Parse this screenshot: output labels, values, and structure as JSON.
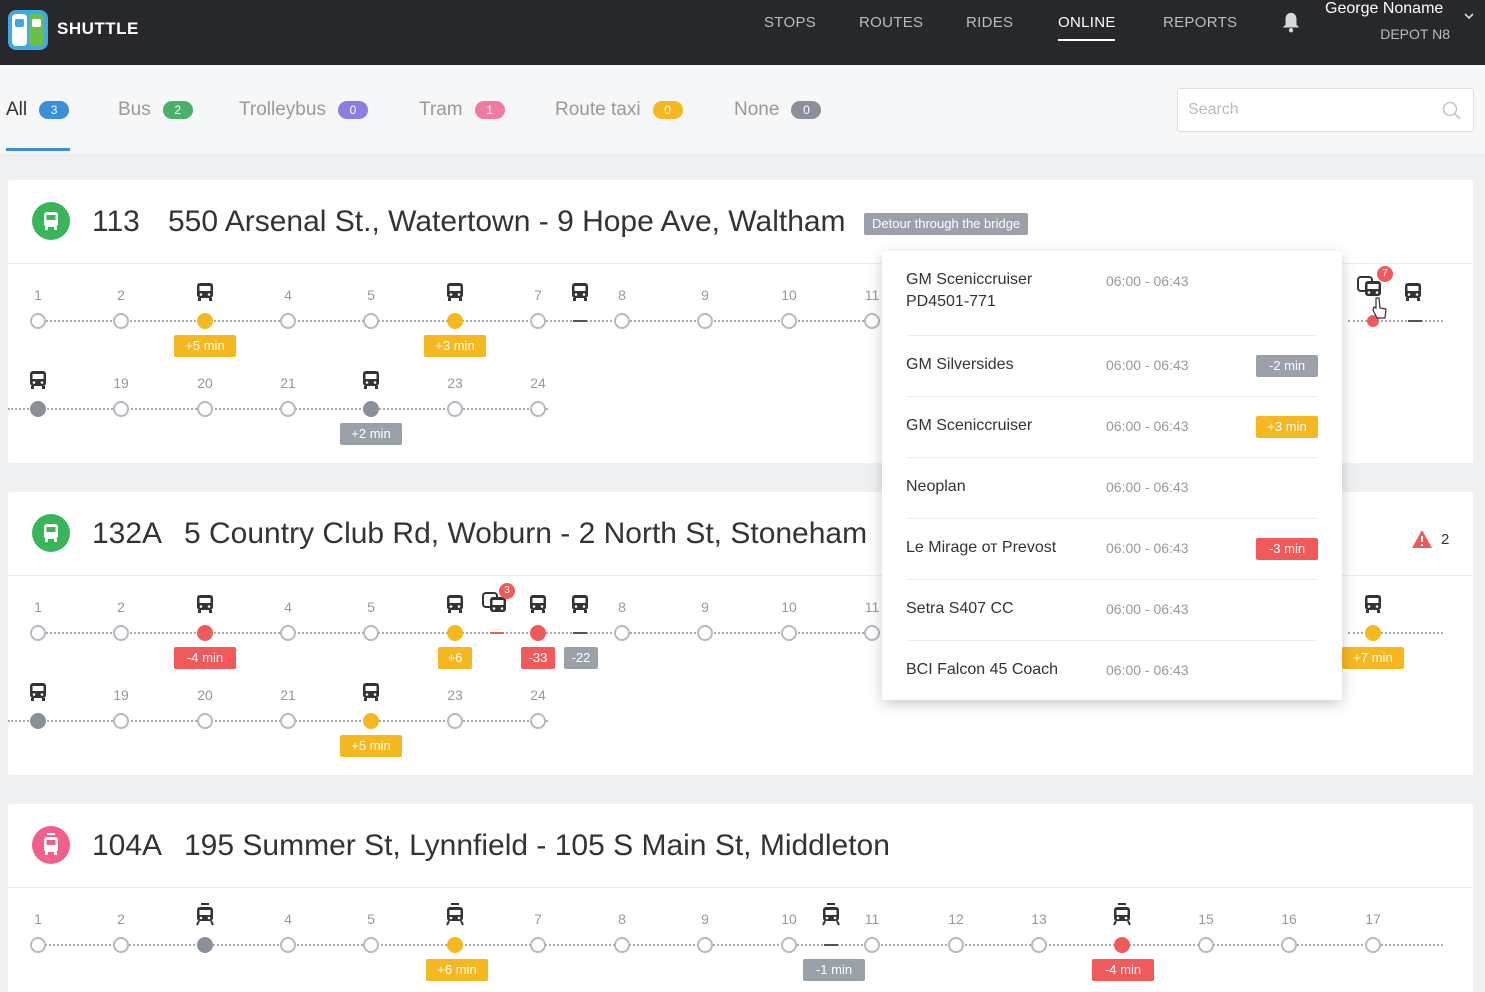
{
  "app": {
    "brand": "SHUTTLE"
  },
  "nav": {
    "items": [
      "STOPS",
      "ROUTES",
      "RIDES",
      "ONLINE",
      "REPORTS"
    ],
    "active": "ONLINE"
  },
  "user": {
    "name": "George Noname",
    "depot": "DEPOT N8"
  },
  "tabs": [
    {
      "label": "All",
      "count": "3",
      "color": "#3b8fd9"
    },
    {
      "label": "Bus",
      "count": "2",
      "color": "#4cb06a"
    },
    {
      "label": "Trolleybus",
      "count": "0",
      "color": "#8c7ee0"
    },
    {
      "label": "Tram",
      "count": "1",
      "color": "#f07aa0"
    },
    {
      "label": "Route taxi",
      "count": "0",
      "color": "#f5b820"
    },
    {
      "label": "None",
      "count": "0",
      "color": "#8a9099"
    }
  ],
  "search": {
    "placeholder": "Search"
  },
  "colors": {
    "green": "#3ab55c",
    "pink": "#f0608a",
    "orange": "#f5b820",
    "red": "#f05a5a",
    "gray": "#9aa1a9",
    "nav_bg": "#26282c"
  },
  "routes": [
    {
      "number": "113",
      "name": "550 Arsenal St., Watertown - 9 Hope Ave, Waltham",
      "tag": "Detour through the bridge",
      "type": "bus",
      "row1_stops": [
        "1",
        "2",
        "4",
        "5",
        "7",
        "8",
        "9",
        "10",
        "11"
      ],
      "row2_stops": [
        "19",
        "20",
        "21",
        "23",
        "24"
      ],
      "delays": [
        "+5 min",
        "+3 min",
        "+2 min"
      ]
    },
    {
      "number": "132A",
      "name": "5 Country Club Rd, Woburn - 2 North St, Stoneham",
      "warning_count": "2",
      "type": "bus",
      "row1_stops": [
        "1",
        "2",
        "4",
        "5",
        "8",
        "9",
        "10",
        "11"
      ],
      "row2_stops": [
        "19",
        "20",
        "21",
        "23",
        "24"
      ],
      "delays": [
        "-4 min",
        "+6",
        "-33",
        "-22",
        "+7 min",
        "+5 min"
      ],
      "group_count": "3"
    },
    {
      "number": "104A",
      "name": "195 Summer St, Lynnfield - 105 S Main St, Middleton",
      "type": "tram",
      "row1_stops": [
        "1",
        "2",
        "4",
        "5",
        "7",
        "8",
        "9",
        "10",
        "11",
        "12",
        "13",
        "15",
        "16",
        "17"
      ],
      "delays": [
        "+6 min",
        "-1 min",
        "-4 min"
      ]
    }
  ],
  "popover": {
    "group_count": "7",
    "rows": [
      {
        "name": "GM Sceniccruiser PD4501-771",
        "time": "06:00 - 06:43",
        "badge": "",
        "color": ""
      },
      {
        "name": "GM Silversides",
        "time": "06:00 - 06:43",
        "badge": "-2 min",
        "color": "#9aa1a9"
      },
      {
        "name": "GM Sceniccruiser",
        "time": "06:00 - 06:43",
        "badge": "+3 min",
        "color": "#f5b820"
      },
      {
        "name": "Neoplan",
        "time": "06:00 - 06:43",
        "badge": "",
        "color": ""
      },
      {
        "name": "Le Mirage от Prevost",
        "time": "06:00 - 06:43",
        "badge": "-3 min",
        "color": "#f05a5a"
      },
      {
        "name": "Setra S407 CC",
        "time": "06:00 - 06:43",
        "badge": "",
        "color": ""
      },
      {
        "name": "BCI Falcon 45 Coach",
        "time": "06:00 - 06:43",
        "badge": "",
        "color": ""
      }
    ]
  }
}
